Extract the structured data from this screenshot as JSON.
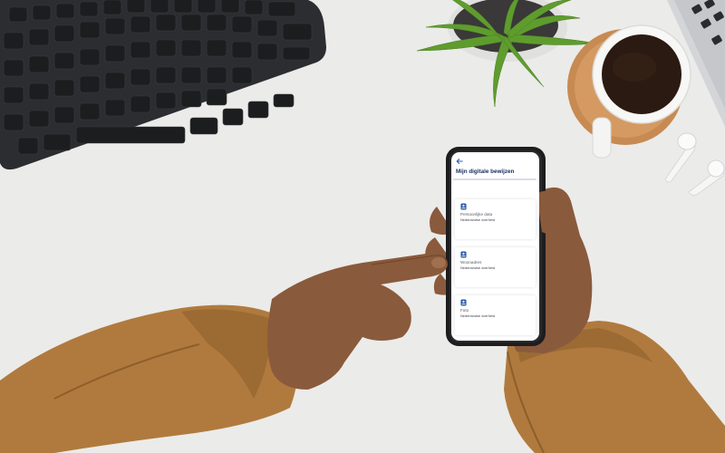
{
  "colors": {
    "desk": "#e9e9e7",
    "sweater": "#b07a3e",
    "skin": "#8a5a3c",
    "keyboard": "#2a2b2e",
    "phone_frame": "#1d1d1f",
    "app_title": "#152a5e",
    "icon_blue": "#2b5cab"
  },
  "app": {
    "back_icon": "arrow-left-icon",
    "title": "Mijn digitale bewijzen",
    "cards": [
      {
        "label": "Persoonlijke data",
        "subtitle": "Nederlandse overheid",
        "icon": "id-badge-icon"
      },
      {
        "label": "Woonadres",
        "subtitle": "Nederlandse overheid",
        "icon": "id-badge-icon"
      },
      {
        "label": "Foto",
        "subtitle": "Nederlandse overheid",
        "icon": "id-badge-icon"
      }
    ]
  }
}
